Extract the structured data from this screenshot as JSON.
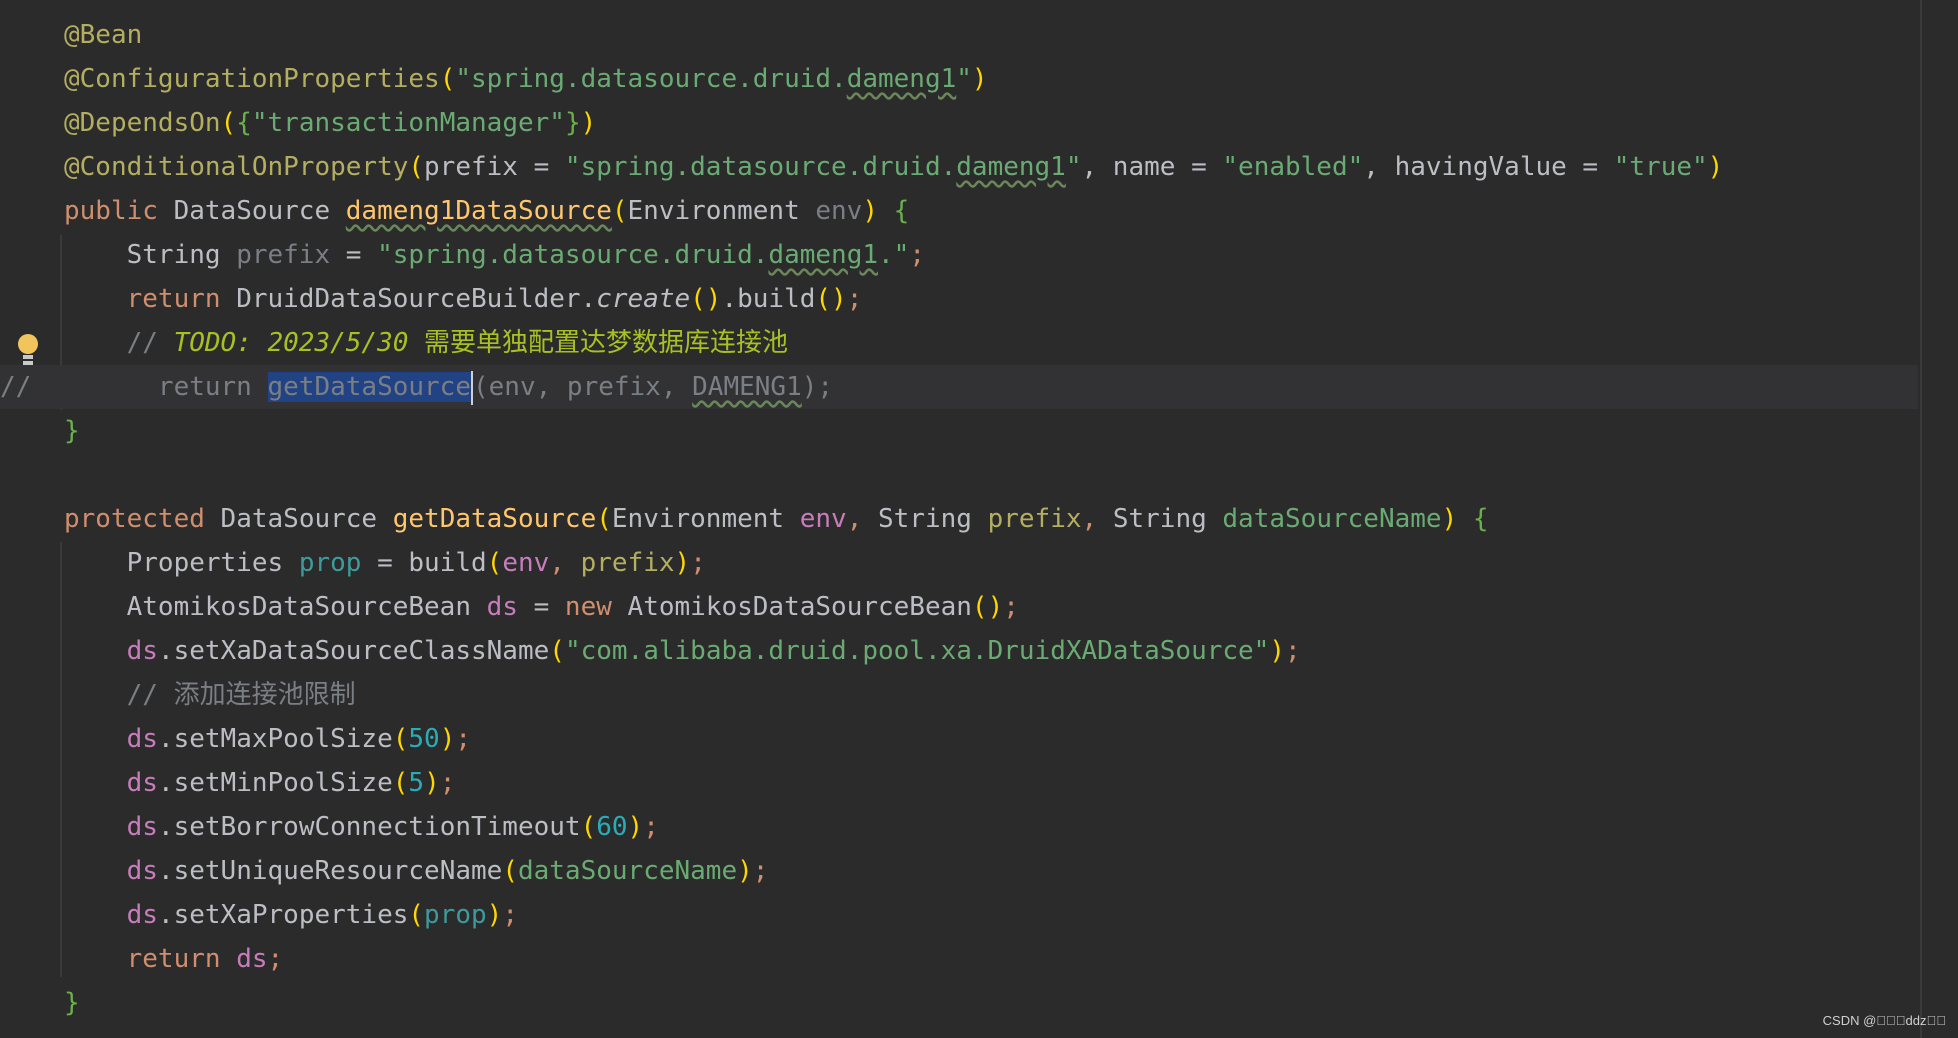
{
  "editor": {
    "current_line_gutter": "//",
    "watermark": "CSDN @\u0000\u0000\u0000ddz\u0000\u0000"
  },
  "code": {
    "l1": {
      "a": "@Bean"
    },
    "l2": {
      "a": "@ConfigurationProperties",
      "b": "(",
      "c": "\"spring.datasource.druid.",
      "d": "dameng1",
      "e": "\"",
      "f": ")"
    },
    "l3": {
      "a": "@DependsOn",
      "b": "(",
      "c": "{",
      "d": "\"transactionManager\"",
      "e": "}",
      "f": ")"
    },
    "l4": {
      "a": "@ConditionalOnProperty",
      "b": "(",
      "c": "prefix = ",
      "d": "\"spring.datasource.druid.",
      "e": "dameng1",
      "f": "\"",
      "g": ", name = ",
      "h": "\"enabled\"",
      "i": ", havingValue = ",
      "j": "\"true\"",
      "k": ")"
    },
    "l5": {
      "a": "public ",
      "b": "DataSource ",
      "c": "dameng1DataSource",
      "d": "(",
      "e": "Environment ",
      "f": "env",
      "g": ") ",
      "h": "{"
    },
    "l6": {
      "a": "    String ",
      "b": "prefix",
      "c": " = ",
      "d": "\"spring.datasource.druid.",
      "e": "dameng1",
      "f": ".\"",
      "g": ";"
    },
    "l7": {
      "a": "    return ",
      "b": "DruidDataSourceBuilder.",
      "c": "create",
      "d": "()",
      "e": ".build",
      "f": "()",
      "g": ";"
    },
    "l8": {
      "a": "    // ",
      "b": "TODO: 2023/5/30 ",
      "c": "需要单独配置达梦数据库连接池"
    },
    "l9": {
      "a": "      return ",
      "b": "getDataSource",
      "c": "(env, prefix, ",
      "d": "DAMENG1",
      "e": ");"
    },
    "l10": {
      "a": "}"
    },
    "l12": {
      "a": "protected ",
      "b": "DataSource ",
      "c": "getDataSource",
      "d": "(",
      "e": "Environment ",
      "f": "env",
      "g": ", ",
      "h": "String ",
      "i": "prefix",
      "j": ", ",
      "k": "String ",
      "l": "dataSourceName",
      "m": ") ",
      "n": "{"
    },
    "l13": {
      "a": "    Properties ",
      "b": "prop",
      "c": " = build",
      "d": "(",
      "e": "env",
      "f": ", ",
      "g": "prefix",
      "h": ")",
      "i": ";"
    },
    "l14": {
      "a": "    AtomikosDataSourceBean ",
      "b": "ds",
      "c": " = ",
      "d": "new ",
      "e": "AtomikosDataSourceBean",
      "f": "()",
      "g": ";"
    },
    "l15": {
      "a": "    ",
      "b": "ds",
      "c": ".setXaDataSourceClassName",
      "d": "(",
      "e": "\"com.alibaba.druid.pool.xa.DruidXADataSource\"",
      "f": ")",
      "g": ";"
    },
    "l16": {
      "a": "    // 添加连接池限制"
    },
    "l17": {
      "a": "    ",
      "b": "ds",
      "c": ".setMaxPoolSize",
      "d": "(",
      "e": "50",
      "f": ")",
      "g": ";"
    },
    "l18": {
      "a": "    ",
      "b": "ds",
      "c": ".setMinPoolSize",
      "d": "(",
      "e": "5",
      "f": ")",
      "g": ";"
    },
    "l19": {
      "a": "    ",
      "b": "ds",
      "c": ".setBorrowConnectionTimeout",
      "d": "(",
      "e": "60",
      "f": ")",
      "g": ";"
    },
    "l20": {
      "a": "    ",
      "b": "ds",
      "c": ".setUniqueResourceName",
      "d": "(",
      "e": "dataSourceName",
      "f": ")",
      "g": ";"
    },
    "l21": {
      "a": "    ",
      "b": "ds",
      "c": ".setXaProperties",
      "d": "(",
      "e": "prop",
      "f": ")",
      "g": ";"
    },
    "l22": {
      "a": "    return ",
      "b": "ds",
      "c": ";"
    },
    "l23": {
      "a": "}"
    }
  }
}
